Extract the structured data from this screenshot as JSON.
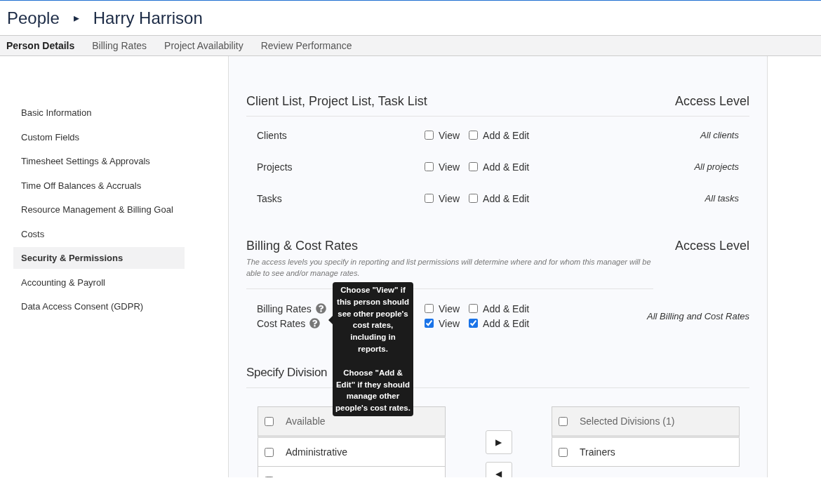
{
  "header": {
    "section": "People",
    "separator": "▸",
    "title": "Harry Harrison"
  },
  "tabs": [
    {
      "label": "Person Details",
      "selected": true
    },
    {
      "label": "Billing Rates",
      "selected": false
    },
    {
      "label": "Project Availability",
      "selected": false
    },
    {
      "label": "Review Performance",
      "selected": false
    }
  ],
  "sidebar": {
    "items": [
      {
        "label": "Basic Information",
        "selected": false
      },
      {
        "label": "Custom Fields",
        "selected": false
      },
      {
        "label": "Timesheet Settings & Approvals",
        "selected": false
      },
      {
        "label": "Time Off Balances & Accruals",
        "selected": false
      },
      {
        "label": "Resource Management & Billing Goal",
        "selected": false
      },
      {
        "label": "Costs",
        "selected": false
      },
      {
        "label": "Security & Permissions",
        "selected": true
      },
      {
        "label": "Accounting & Payroll",
        "selected": false
      },
      {
        "label": "Data Access Consent (GDPR)",
        "selected": false
      }
    ]
  },
  "list_section": {
    "title": "Client List, Project List, Task List",
    "access_heading": "Access Level",
    "rows": [
      {
        "label": "Clients",
        "options": [
          {
            "label": "View",
            "checked": false
          },
          {
            "label": "Add & Edit",
            "checked": false
          }
        ],
        "access": "All clients"
      },
      {
        "label": "Projects",
        "options": [
          {
            "label": "View",
            "checked": false
          },
          {
            "label": "Add & Edit",
            "checked": false
          }
        ],
        "access": "All projects"
      },
      {
        "label": "Tasks",
        "options": [
          {
            "label": "View",
            "checked": false
          },
          {
            "label": "Add & Edit",
            "checked": false
          }
        ],
        "access": "All tasks"
      }
    ]
  },
  "billing": {
    "title": "Billing & Cost Rates",
    "access_heading": "Access Level",
    "note": "The access levels you specify in reporting and list permissions will determine where and for whom this manager will be able to see and/or manage rates.",
    "rows": [
      {
        "label": "Billing Rates",
        "options": [
          {
            "label": "View",
            "checked": false
          },
          {
            "label": "Add & Edit",
            "checked": false
          }
        ]
      },
      {
        "label": "Cost Rates",
        "options": [
          {
            "label": "View",
            "checked": true
          },
          {
            "label": "Add & Edit",
            "checked": true
          }
        ]
      }
    ],
    "access": "All Billing and Cost Rates"
  },
  "tooltip": {
    "paragraphs": [
      "Choose \"View\" if this person should see other people's cost rates, including in reports.",
      "Choose \"Add & Edit\" if they should manage other people's cost rates."
    ]
  },
  "divisions": {
    "title": "Specify Division",
    "available": {
      "header": "Available",
      "checked": false,
      "items": [
        {
          "label": "Administrative",
          "checked": false
        },
        {
          "checked": false
        }
      ]
    },
    "move_buttons": [
      "▶",
      "◀"
    ],
    "selected": {
      "header": "Selected Divisions (1)",
      "checked": false,
      "items": [
        {
          "label": "Trainers",
          "checked": false
        }
      ]
    }
  }
}
